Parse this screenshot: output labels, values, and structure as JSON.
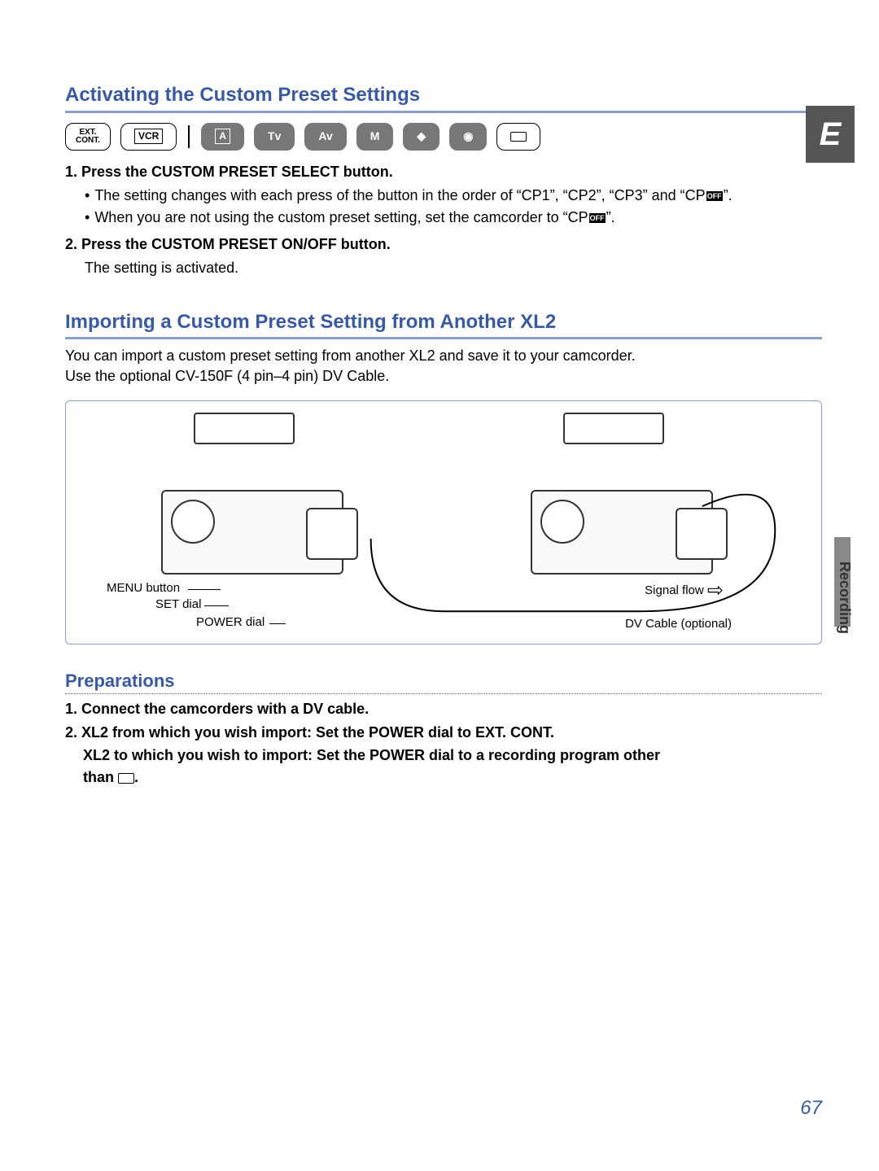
{
  "tab_letter": "E",
  "side_label": "Recording",
  "page_number": "67",
  "section1": {
    "title": "Activating the Custom Preset Settings",
    "modes": {
      "ext": "EXT.\nCONT.",
      "vcr": "VCR",
      "a": "A",
      "tv": "Tv",
      "av": "Av",
      "m": "M"
    },
    "step1": "1. Press the CUSTOM PRESET SELECT button.",
    "step1_b1_pre": "The setting changes with each press of the button in the order of “CP1”, “CP2”, “CP3” and “CP",
    "step1_b1_post": "”.",
    "step1_b2_pre": "When you are not using the custom preset setting, set the camcorder to “CP",
    "step1_b2_post": "”.",
    "off_label": "OFF",
    "step2": "2. Press the CUSTOM PRESET ON/OFF button.",
    "step2_sub": "The setting is activated."
  },
  "section2": {
    "title": "Importing a Custom Preset Setting from Another XL2",
    "intro1": "You can import a custom preset setting from another XL2 and save it to your camcorder.",
    "intro2": "Use the optional CV-150F (4 pin–4 pin) DV Cable.",
    "fig": {
      "menu_btn": "MENU button",
      "set_dial": "SET dial",
      "power_dial": "POWER dial",
      "signal_flow": "Signal flow",
      "dv_cable": "DV Cable (optional)"
    },
    "prep_title": "Preparations",
    "prep1": "1. Connect the camcorders with a DV cable.",
    "prep2_l1": "2. XL2 from which you wish import: Set the POWER dial to EXT. CONT.",
    "prep2_l2": "XL2 to which you wish to import: Set the POWER dial to a recording program other",
    "prep2_l3_pre": "than ",
    "prep2_l3_post": "."
  }
}
